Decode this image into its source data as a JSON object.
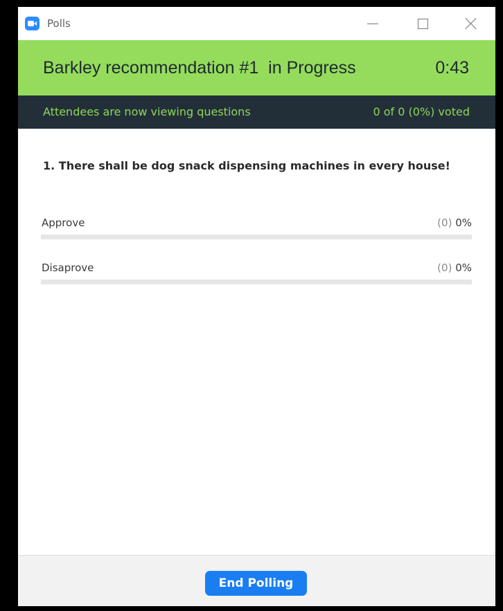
{
  "window": {
    "title": "Polls",
    "icon": "zoom-camera-icon",
    "controls": [
      "minimize-icon",
      "maximize-icon",
      "close-icon"
    ]
  },
  "header": {
    "poll_title": "Barkley recommendation #1  in Progress",
    "timer": "0:43",
    "background_color": "#95dc5d"
  },
  "status": {
    "message": "Attendees are now viewing questions",
    "votes": "0 of 0 (0%) voted",
    "text_color": "#8ed65a",
    "background_color": "#232f38"
  },
  "question": {
    "text": "1. There shall be dog snack dispensing machines in every house!",
    "answers": [
      {
        "label": "Approve",
        "count": "(0)",
        "percent": "0%",
        "fraction": 0
      },
      {
        "label": "Disaprove",
        "count": "(0)",
        "percent": "0%",
        "fraction": 0
      }
    ]
  },
  "footer": {
    "end_button_label": "End Polling",
    "accent_color": "#1a7ef2"
  }
}
